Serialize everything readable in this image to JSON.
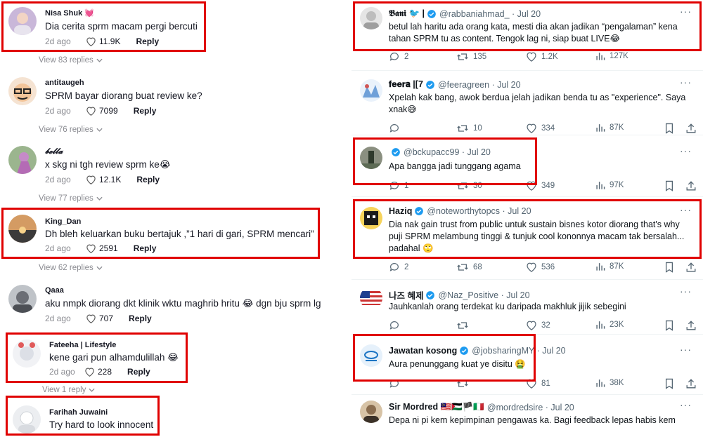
{
  "left_comments": [
    {
      "name": "Nisa Shuk 💓",
      "text": "Dia cerita sprm macam pergi bercuti",
      "date": "2d ago",
      "likes": "11.9K",
      "reply": "Reply",
      "view_replies": "View 83 replies",
      "avatar_color": "#c9b7d9"
    },
    {
      "name": "antitaugeh",
      "text": "SPRM bayar diorang buat review ke?",
      "date": "2d ago",
      "likes": "7099",
      "reply": "Reply",
      "view_replies": "View 76 replies",
      "avatar_color": "#f3c59a"
    },
    {
      "name": "𝓫𝓮𝓵𝓵𝓪",
      "text": "x skg ni tgh review sprm ke😭",
      "date": "2d ago",
      "likes": "12.1K",
      "reply": "Reply",
      "view_replies": "View 77 replies",
      "avatar_color": "#b98ab9"
    },
    {
      "name": "King_Dan",
      "text": "Dh bleh keluarkan buku bertajuk ,”1 hari di gari, SPRM mencari”",
      "date": "2d ago",
      "likes": "2591",
      "reply": "Reply",
      "view_replies": "View 62 replies",
      "avatar_color": "#7a6a55"
    },
    {
      "name": "Qaaa",
      "text": "aku nmpk diorang dkt klinik wktu maghrib hritu 😂 dgn bju sprm lg",
      "date": "2d ago",
      "likes": "707",
      "reply": "Reply",
      "view_replies": "",
      "avatar_color": "#8c8f96"
    },
    {
      "name": "Fateeha | Lifestyle",
      "text": "kene gari pun alhamdulillah 😂",
      "date": "2d ago",
      "likes": "228",
      "reply": "Reply",
      "view_replies": "View 1 reply",
      "avatar_color": "#dcdfe6"
    },
    {
      "name": "Farihah Juwaini",
      "text": "Try hard to look innocent",
      "date": "",
      "likes": "",
      "reply": "",
      "view_replies": "",
      "avatar_color": "#e8e8ea"
    }
  ],
  "right_tweets": [
    {
      "name": "𝕭𝖆𝖓𝖎 🐦 |",
      "handle": "@rabbaniahmad_ · Jul 20",
      "verified": true,
      "text": "betul lah haritu ada orang kata, mesti dia akan jadikan “pengalaman” kena tahan SPRM tu as content. Tengok lag ni, siap buat LIVE😂",
      "replies": "2",
      "retweets": "135",
      "likes": "1.2K",
      "views": "127K",
      "avatar_color": "#d9d9d9"
    },
    {
      "name": "𝐟𝐞𝐞𝐫𝐚 |[7",
      "handle": "@feeragreen · Jul 20",
      "verified": true,
      "text": "Xpelah kak bang, awok berdua jelah jadikan benda tu as \"experience\". Saya xnak😅",
      "replies": "",
      "retweets": "10",
      "likes": "334",
      "views": "87K",
      "avatar_color": "#6fa0d8"
    },
    {
      "name": "",
      "handle": "@bckupacc99 · Jul 20",
      "verified": true,
      "text": "Apa bangga jadi tunggang agama",
      "replies": "1",
      "retweets": "30",
      "likes": "349",
      "views": "97K",
      "avatar_color": "#5d6b55"
    },
    {
      "name": "Haziq",
      "handle": "@noteworthytopcs · Jul 20",
      "verified": true,
      "text": "Dia nak gain trust from public untuk sustain bisnes kotor diorang that's why puji SPRM melambung tinggi & tunjuk cool kononnya macam tak bersalah... padahal 🙄",
      "replies": "2",
      "retweets": "68",
      "likes": "536",
      "views": "87K",
      "avatar_color": "#f1c232"
    },
    {
      "name": "나즈 혜제",
      "handle": "@Naz_Positive · Jul 20",
      "verified": true,
      "text": "Jauhkanlah orang terdekat ku daripada makhluk jijik sebegini",
      "replies": "",
      "retweets": "",
      "likes": "32",
      "views": "23K",
      "avatar_color": "#cc3333"
    },
    {
      "name": "Jawatan kosong",
      "handle": "@jobsharingMY · Jul 20",
      "verified": true,
      "text": "Aura penunggang kuat ye disitu 🤮",
      "replies": "",
      "retweets": "",
      "likes": "81",
      "views": "38K",
      "avatar_color": "#e6f1fb"
    },
    {
      "name": "Sir Mordred 🇲🇾🇵🇸🏴🇮🇹",
      "handle": "@mordredsire · Jul 20",
      "verified": false,
      "text": "Depa ni pi kem kepimpinan pengawas ka. Bagi feedback lepas habis kem",
      "replies": "",
      "retweets": "",
      "likes": "",
      "views": "",
      "avatar_color": "#8a6d4f"
    }
  ]
}
